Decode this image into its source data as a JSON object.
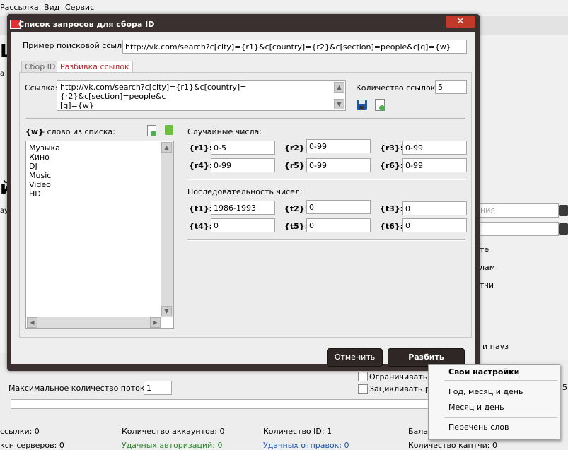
{
  "bg": {
    "menu": [
      "Рассылка",
      "Вид",
      "Сервис"
    ],
    "left_big1": "ЦЕ",
    "left_small1": "а",
    "left_big2": "й",
    "left_small2": "аунт",
    "right_combo_placeholder": "ния",
    "right_labels": [
      "те",
      "лам",
      "тчи",
      "и пауз"
    ],
    "max_threads_label": "Максимальное количество потоков:",
    "max_threads_value": "1",
    "limit_label": "Ограничивать п",
    "loop_label": "Зацикливать ра",
    "right_partial_value": "5",
    "stats_row1": [
      "ссылки: 0",
      "Количество аккаунтов: 0",
      "Количество ID: 1",
      "Балан"
    ],
    "stats_row2": [
      "ксн серверов: 0",
      "Удачных авторизаций: 0",
      "Удачных отправок: 0",
      "Количество каптчи: 0"
    ]
  },
  "dialog": {
    "title": "Список запросов для сбора ID",
    "close_glyph": "✕",
    "example_label": "Пример поисковой ссылки:",
    "example_value": "http://vk.com/search?c[city]={r1}&c[country]={r2}&c[section]=people&c[q]={w}",
    "tabs": [
      "Сбор ID",
      "Разбивка ссылок"
    ],
    "link_label": "Ссылка:",
    "link_value_line1": "http://vk.com/search?c[city]={r1}&c[country]={r2}&c[section]=people&c",
    "link_value_line2": "[q]={w}",
    "count_label": "Количество ссылок:",
    "count_value": "5",
    "w_tag": "{w}",
    "w_desc": " - слово из списка:",
    "words": [
      "Музыка",
      "Кино",
      "DJ",
      "Music",
      "Video",
      "HD"
    ],
    "random_header": "Случайные числа:",
    "random": [
      {
        "tag": "{r1}:",
        "value": "0-5"
      },
      {
        "tag": "{r2}:",
        "value": "0-99"
      },
      {
        "tag": "{r3}:",
        "value": "0-99"
      },
      {
        "tag": "{r4}:",
        "value": "0-99"
      },
      {
        "tag": "{r5}:",
        "value": "0-99"
      },
      {
        "tag": "{r6}:",
        "value": "0-99"
      }
    ],
    "seq_header": "Последовательность чисел:",
    "seq": [
      {
        "tag": "{t1}:",
        "value": "1986-1993"
      },
      {
        "tag": "{t2}:",
        "value": "0"
      },
      {
        "tag": "{t3}:",
        "value": "0"
      },
      {
        "tag": "{t4}:",
        "value": "0"
      },
      {
        "tag": "{t5}:",
        "value": "0"
      },
      {
        "tag": "{t6}:",
        "value": "0"
      }
    ],
    "cancel_label": "Отменить",
    "split_label": "Разбить"
  },
  "context_menu": {
    "items": [
      "Свои настройки",
      "Год, месяц и день",
      "Месяц и день",
      "Перечень слов"
    ]
  },
  "colors": {
    "dialog_frame": "#3b3030",
    "active_tab_text": "#c0262c",
    "close_button": "#c0392b"
  }
}
